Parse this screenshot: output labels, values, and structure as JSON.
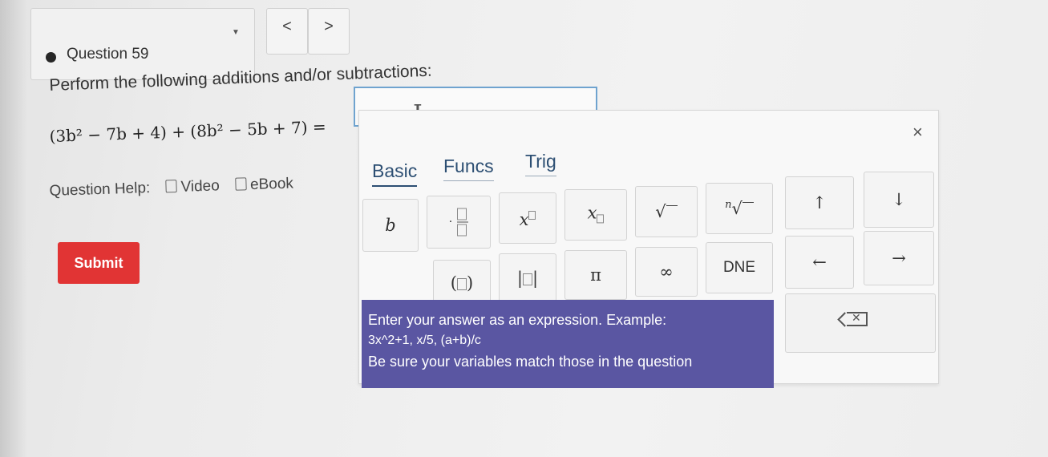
{
  "question_nav": {
    "question_label": "Question 59",
    "prev_label": "<",
    "next_label": ">"
  },
  "question": {
    "prompt": "Perform the following additions and/or subtractions:",
    "expression": "(3b² − 7b + 4) + (8b² − 5b + 7) ="
  },
  "answer": {
    "value": ""
  },
  "help": {
    "label": "Question Help:",
    "video": "Video",
    "ebook": "eBook"
  },
  "submit_label": "Submit",
  "keyboard": {
    "close": "×",
    "tabs": {
      "basic": "Basic",
      "funcs": "Funcs",
      "trig": "Trig"
    },
    "keys": {
      "b": "b",
      "up": "↑",
      "down": "↓",
      "pi": "π",
      "infinity": "∞",
      "dne": "DNE",
      "left": "←",
      "right": "→"
    },
    "hint": {
      "line1": "Enter your answer as an expression. Example:",
      "line2": "3x^2+1, x/5, (a+b)/c",
      "line3": "Be sure your variables match those in the question"
    }
  },
  "colors": {
    "submit": "#e13434",
    "hint_bg": "#5a56a2",
    "tab_text": "#2d4f73",
    "input_border": "#6fa3cf"
  }
}
